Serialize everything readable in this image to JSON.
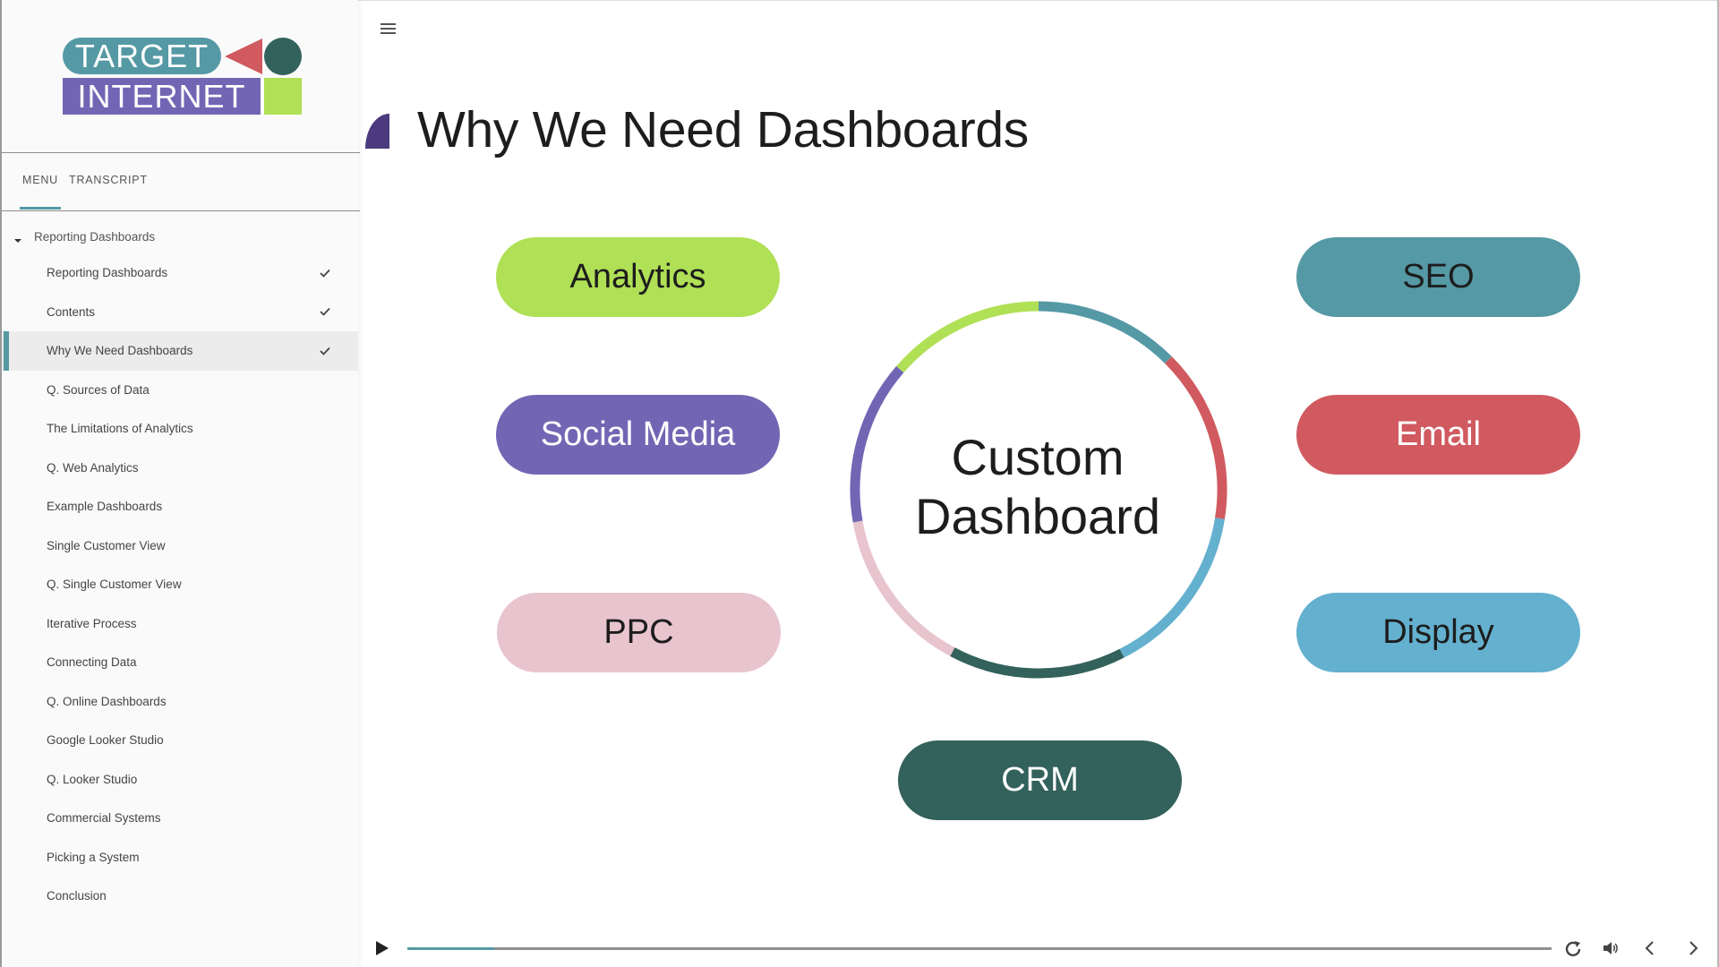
{
  "logo": {
    "line1": "TARGET",
    "line2": "INTERNET",
    "colors": {
      "teal": "#5599a5",
      "purple": "#7266b4",
      "red": "#d05a60",
      "dark_green": "#33615c",
      "lime": "#b0e055"
    }
  },
  "sidebar": {
    "tabs": [
      {
        "label": "MENU",
        "active": true
      },
      {
        "label": "TRANSCRIPT",
        "active": false
      }
    ],
    "group": {
      "label": "Reporting Dashboards",
      "expanded": true
    },
    "items": [
      {
        "label": "Reporting Dashboards",
        "completed": true,
        "active": false
      },
      {
        "label": "Contents",
        "completed": true,
        "active": false
      },
      {
        "label": "Why We Need Dashboards",
        "completed": true,
        "active": true
      },
      {
        "label": "Q. Sources of Data",
        "completed": false,
        "active": false
      },
      {
        "label": "The Limitations of Analytics",
        "completed": false,
        "active": false
      },
      {
        "label": "Q. Web Analytics",
        "completed": false,
        "active": false
      },
      {
        "label": "Example Dashboards",
        "completed": false,
        "active": false
      },
      {
        "label": "Single Customer View",
        "completed": false,
        "active": false
      },
      {
        "label": "Q. Single Customer View",
        "completed": false,
        "active": false
      },
      {
        "label": "Iterative Process",
        "completed": false,
        "active": false
      },
      {
        "label": "Connecting Data",
        "completed": false,
        "active": false
      },
      {
        "label": "Q. Online Dashboards",
        "completed": false,
        "active": false
      },
      {
        "label": "Google Looker Studio",
        "completed": false,
        "active": false
      },
      {
        "label": "Q. Looker Studio",
        "completed": false,
        "active": false
      },
      {
        "label": "Commercial Systems",
        "completed": false,
        "active": false
      },
      {
        "label": "Picking a System",
        "completed": false,
        "active": false
      },
      {
        "label": "Conclusion",
        "completed": false,
        "active": false
      }
    ]
  },
  "slide": {
    "title": "Why We Need Dashboards",
    "title_icon_color": "#4b3a7e",
    "center_label_line1": "Custom",
    "center_label_line2": "Dashboard",
    "pills": [
      {
        "id": "analytics",
        "label": "Analytics",
        "bg": "#b0e055",
        "fg": "#1d1d1d"
      },
      {
        "id": "social-media",
        "label": "Social Media",
        "bg": "#7266b4",
        "fg": "#ffffff"
      },
      {
        "id": "ppc",
        "label": "PPC",
        "bg": "#e8c4ce",
        "fg": "#1d1d1d"
      },
      {
        "id": "seo",
        "label": "SEO",
        "bg": "#5599a5",
        "fg": "#1d1d1d"
      },
      {
        "id": "email",
        "label": "Email",
        "bg": "#d05a60",
        "fg": "#ffffff"
      },
      {
        "id": "display",
        "label": "Display",
        "bg": "#64b0cf",
        "fg": "#1d1d1d"
      },
      {
        "id": "crm",
        "label": "CRM",
        "bg": "#33615c",
        "fg": "#ffffff"
      }
    ],
    "ring_segments": [
      {
        "name": "seo",
        "color": "#5599a5",
        "start_deg": 0,
        "end_deg": 45
      },
      {
        "name": "email",
        "color": "#d05a60",
        "start_deg": 45,
        "end_deg": 99
      },
      {
        "name": "display",
        "color": "#64b0cf",
        "start_deg": 99,
        "end_deg": 153
      },
      {
        "name": "crm",
        "color": "#33615c",
        "start_deg": 153,
        "end_deg": 208
      },
      {
        "name": "ppc",
        "color": "#e8c4ce",
        "start_deg": 208,
        "end_deg": 260
      },
      {
        "name": "social-media",
        "color": "#7266b4",
        "start_deg": 260,
        "end_deg": 311
      },
      {
        "name": "analytics",
        "color": "#b0e055",
        "start_deg": 311,
        "end_deg": 360
      }
    ]
  },
  "player": {
    "progress_percent": 7.6,
    "accent": "#5599a5",
    "controls": [
      "play-icon",
      "replay-icon",
      "volume-icon",
      "previous-icon",
      "next-icon"
    ]
  }
}
